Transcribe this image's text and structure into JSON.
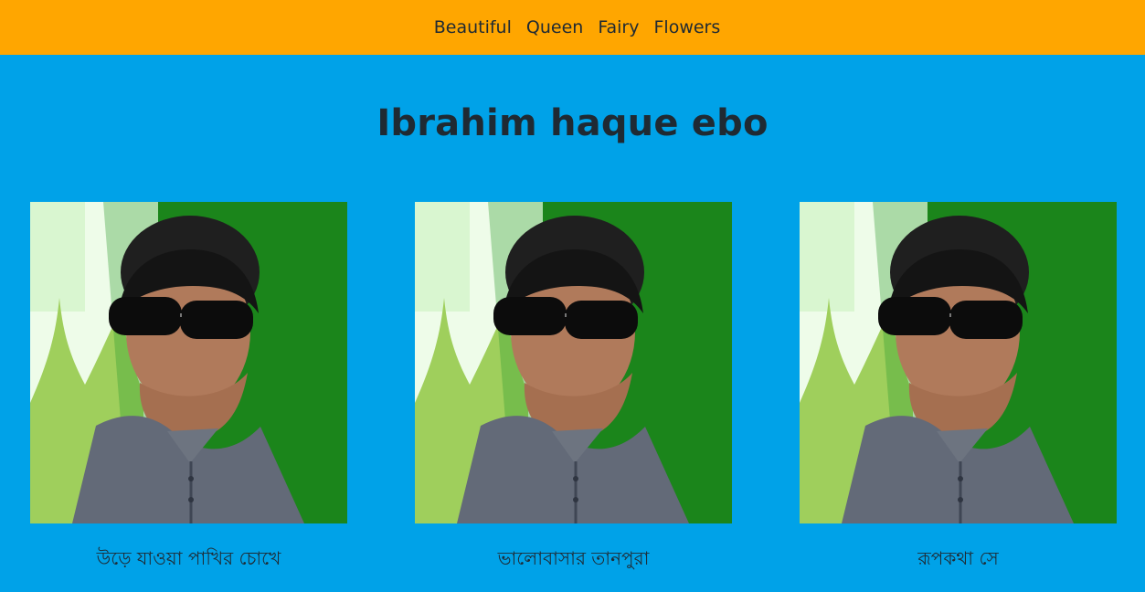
{
  "nav": {
    "items": [
      {
        "label": "Beautiful"
      },
      {
        "label": "Queen"
      },
      {
        "label": "Fairy"
      },
      {
        "label": "Flowers"
      }
    ]
  },
  "page": {
    "title": "Ibrahim haque ebo"
  },
  "cards": [
    {
      "caption": "উড়ে যাওয়া পাখির চোখে",
      "image_alt": "portrait-photo"
    },
    {
      "caption": "ভালোবাসার তানপুরা",
      "image_alt": "portrait-photo"
    },
    {
      "caption": "রূপকথা সে",
      "image_alt": "portrait-photo"
    }
  ],
  "colors": {
    "topbar": "#ffa600",
    "page_bg": "#00a2e8",
    "text": "#1f2a33",
    "photo_green": "#1f8c1f"
  }
}
